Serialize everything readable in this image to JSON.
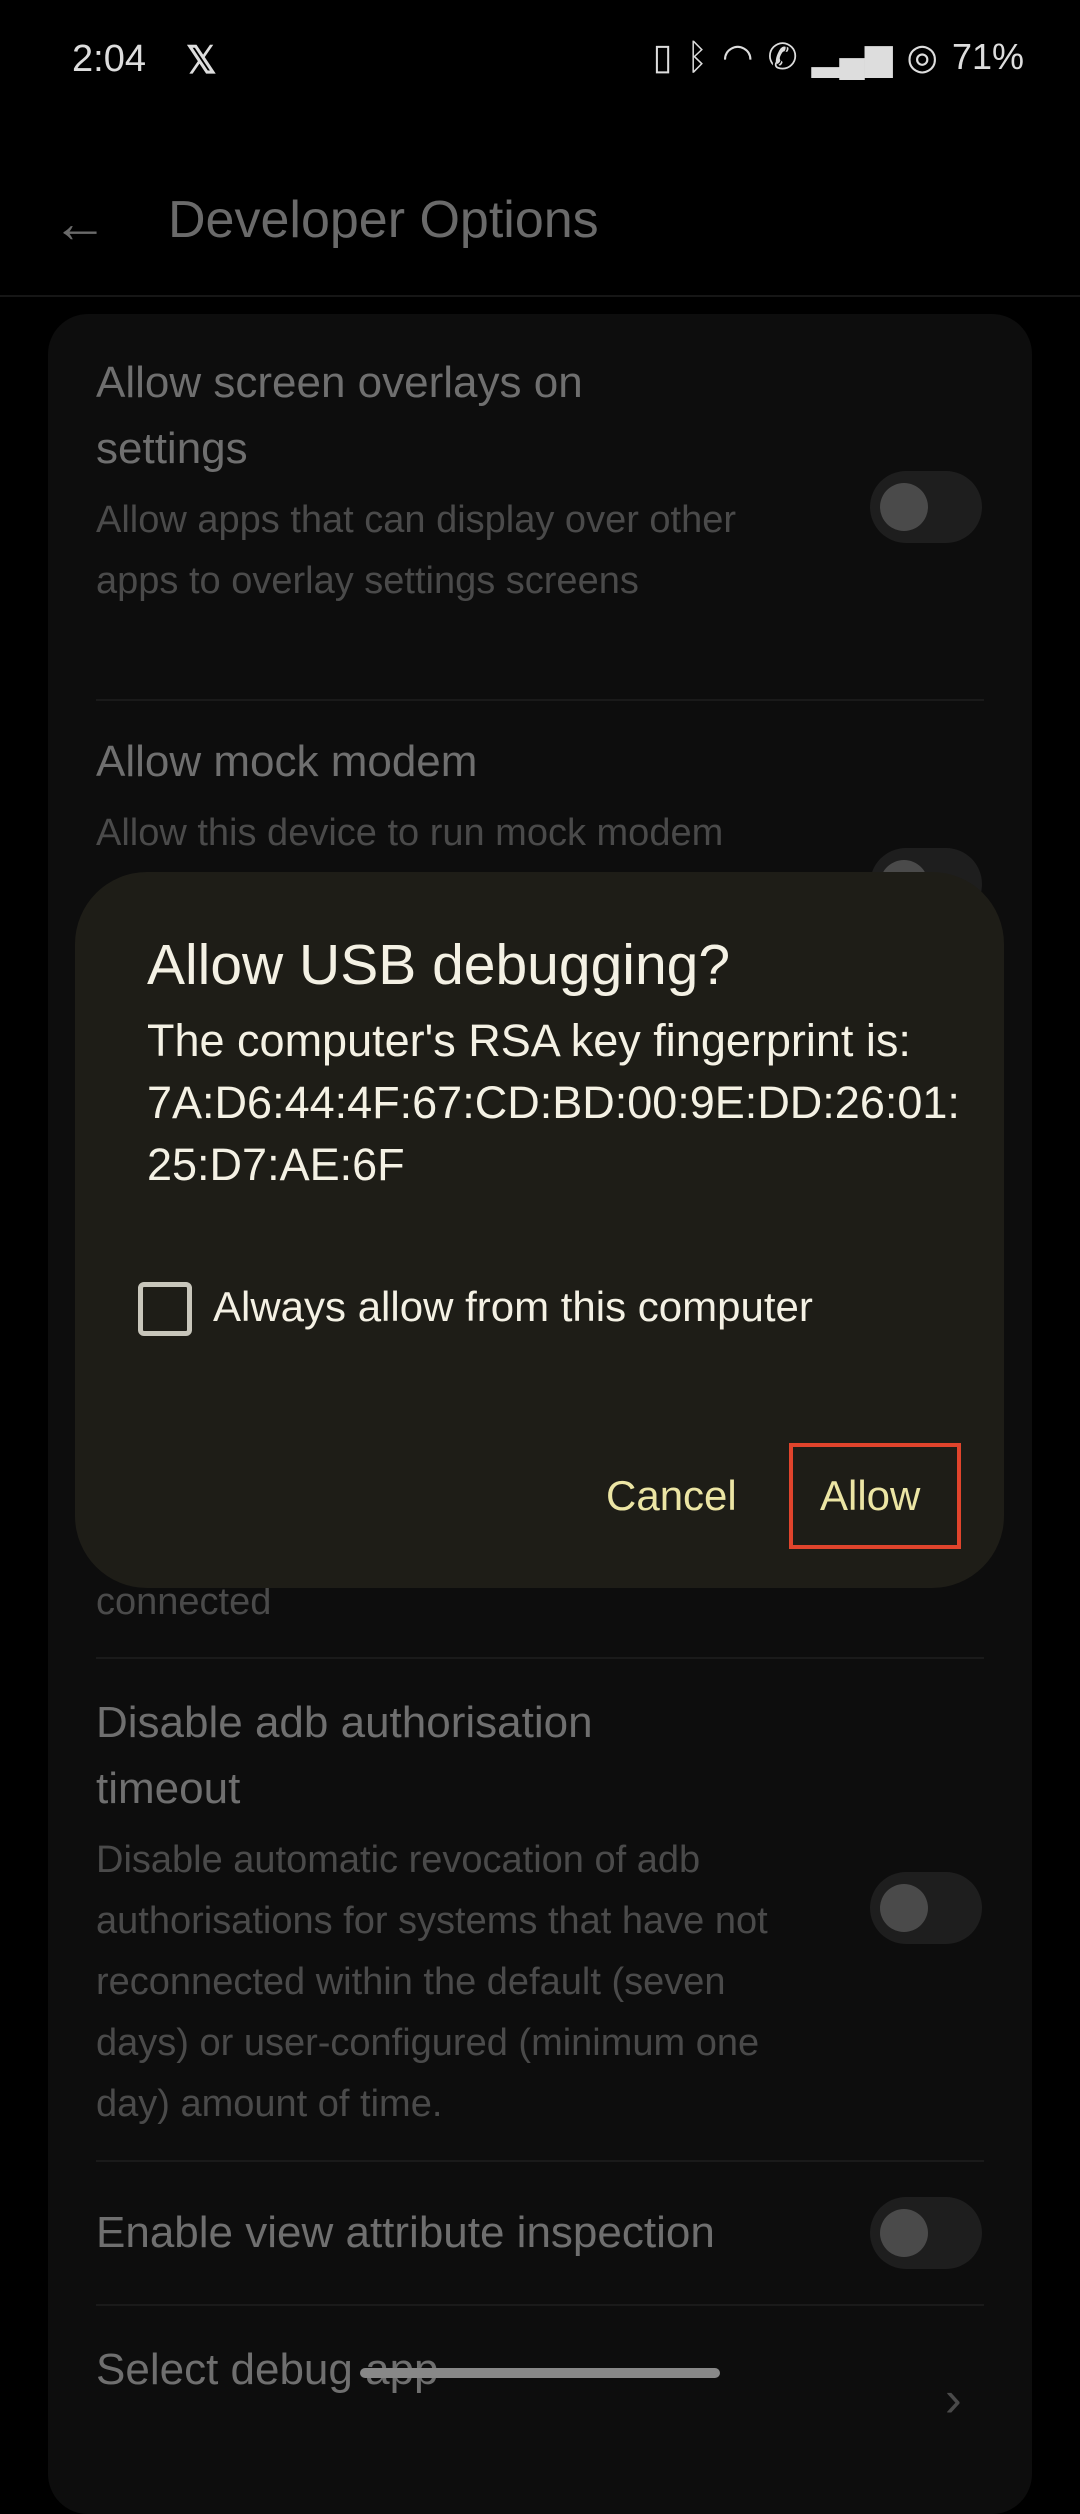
{
  "status_bar": {
    "time": "2:04",
    "notification_icon": "x-logo-icon",
    "icons": [
      "vibrate-icon",
      "bluetooth-icon",
      "wifi-icon",
      "wifi-calling-icon",
      "signal-icon",
      "battery-icon"
    ],
    "battery": "71%"
  },
  "header": {
    "title": "Developer Options",
    "back_icon": "arrow-left-icon"
  },
  "settings": [
    {
      "title": "Allow screen overlays on settings",
      "subtitle": "Allow apps that can display over other apps to overlay settings screens",
      "enabled": false
    },
    {
      "title": "Allow mock modem",
      "subtitle": "Allow this device to run mock modem",
      "enabled": false
    },
    {
      "partial_text": "connected"
    },
    {
      "title": "Disable adb authorisation timeout",
      "subtitle": "Disable automatic revocation of adb authorisations for systems that have not reconnected within the default (seven days) or user-configured (minimum one day) amount of time.",
      "enabled": false
    },
    {
      "title": "Enable view attribute inspection",
      "enabled": false
    },
    {
      "title": "Select debug app"
    }
  ],
  "dialog": {
    "title": "Allow USB debugging?",
    "body": "The computer's RSA key fingerprint is:",
    "fingerprint": "7A:D6:44:4F:67:CD:BD:00:9E:DD:26:01:25:D7:AE:6F",
    "checkbox_label": "Always allow from this computer",
    "checkbox_checked": false,
    "cancel": "Cancel",
    "allow": "Allow",
    "highlight_color": "#e0442c",
    "accent_color": "#ece5a4"
  }
}
